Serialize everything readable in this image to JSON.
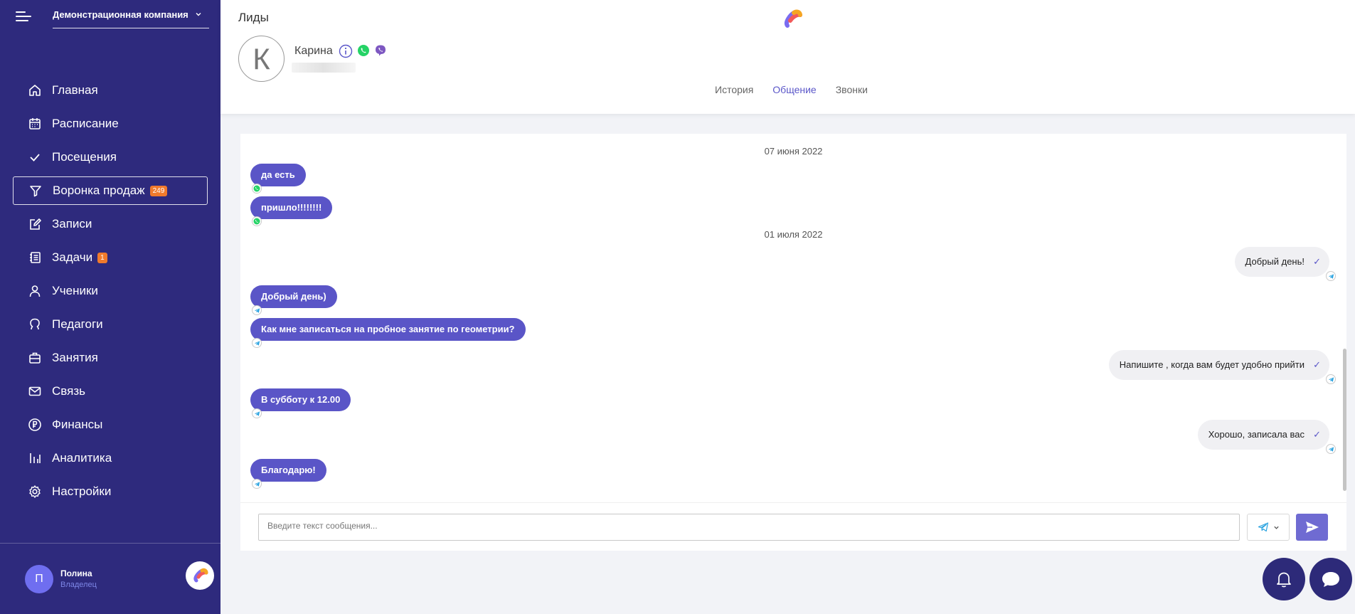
{
  "sidebar": {
    "company": "Демонстрационная компания",
    "menu": [
      {
        "label": "Главная",
        "icon": "home-icon"
      },
      {
        "label": "Расписание",
        "icon": "calendar-icon"
      },
      {
        "label": "Посещения",
        "icon": "check-icon"
      },
      {
        "label": "Воронка продаж",
        "icon": "filter-icon",
        "badge": "249",
        "active": true
      },
      {
        "label": "Записи",
        "icon": "edit-icon"
      },
      {
        "label": "Задачи",
        "icon": "tasks-icon",
        "badge": "1"
      },
      {
        "label": "Ученики",
        "icon": "user-icon"
      },
      {
        "label": "Педагоги",
        "icon": "teacher-icon"
      },
      {
        "label": "Занятия",
        "icon": "briefcase-icon"
      },
      {
        "label": "Связь",
        "icon": "mail-icon"
      },
      {
        "label": "Финансы",
        "icon": "ruble-icon"
      },
      {
        "label": "Аналитика",
        "icon": "chart-icon"
      },
      {
        "label": "Настройки",
        "icon": "gear-icon"
      }
    ],
    "user": {
      "initial": "П",
      "name": "Полина",
      "role": "Владелец"
    }
  },
  "header": {
    "title": "Лиды",
    "contact": {
      "initial": "К",
      "name": "Карина"
    },
    "tabs": [
      {
        "label": "История",
        "active": false
      },
      {
        "label": "Общение",
        "active": true
      },
      {
        "label": "Звонки",
        "active": false
      }
    ]
  },
  "chat": {
    "dates": [
      "07 июня 2022",
      "01 июля 2022"
    ],
    "messages": [
      {
        "dir": "in",
        "text": "да есть",
        "channel": "whatsapp"
      },
      {
        "dir": "in",
        "text": "пришло!!!!!!!!",
        "channel": "whatsapp"
      },
      {
        "dir": "out",
        "text": "Добрый день!",
        "channel": "telegram"
      },
      {
        "dir": "in",
        "text": "Добрый день)",
        "channel": "telegram"
      },
      {
        "dir": "in",
        "text": "Как мне записаться на пробное занятие по геометрии?",
        "channel": "telegram"
      },
      {
        "dir": "out",
        "text": "Напишите , когда вам будет удобно прийти",
        "channel": "telegram"
      },
      {
        "dir": "in",
        "text": "В субботу к 12.00",
        "channel": "telegram"
      },
      {
        "dir": "out",
        "text": "Хорошо, записала вас",
        "channel": "telegram"
      },
      {
        "dir": "in",
        "text": "Благодарю!",
        "channel": "telegram"
      }
    ],
    "input_placeholder": "Введите текст сообщения..."
  },
  "colors": {
    "sidebar": "#2e2a7d",
    "accent": "#5a55c7",
    "badge": "#f07a2c",
    "whatsapp": "#25d366",
    "viber": "#7d57c1",
    "telegram": "#2aa3e0"
  }
}
